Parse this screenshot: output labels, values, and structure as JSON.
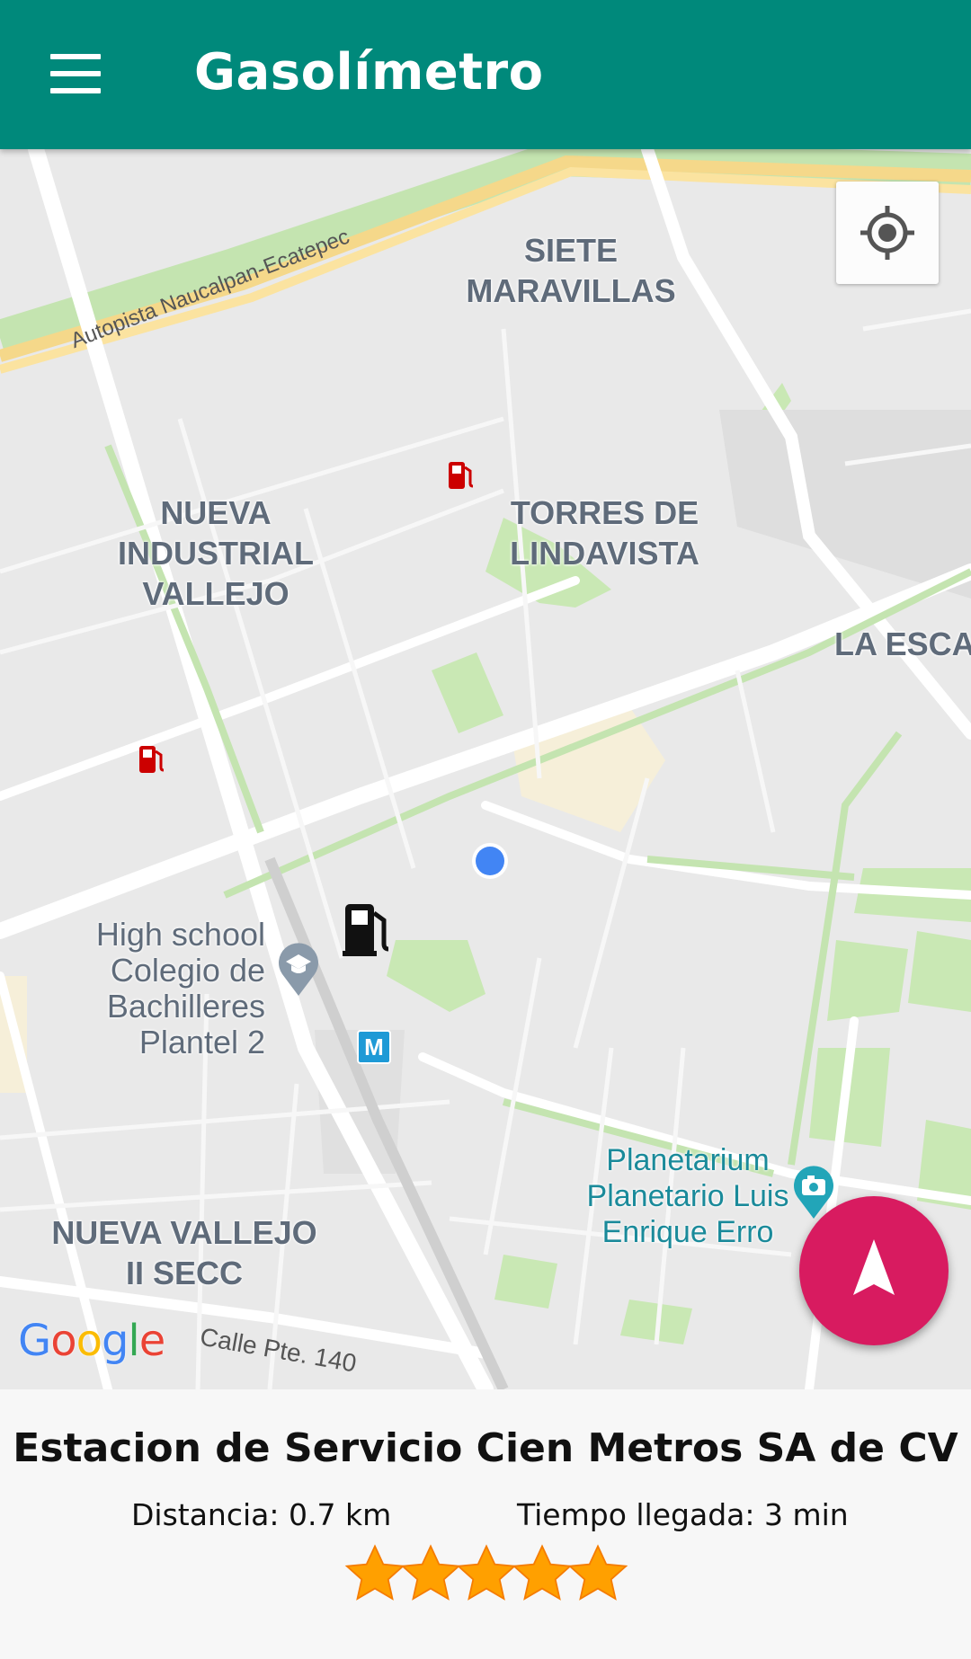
{
  "app": {
    "title": "Gasolímetro",
    "colors": {
      "appbar": "#00897b",
      "fab": "#d81b60",
      "location_dot": "#4285f4",
      "station_marker": "#cc0000"
    }
  },
  "map": {
    "areas": {
      "siete_maravillas": "SIETE\nMARAVILLAS",
      "torres_de_lindavista": "TORRES DE\nLINDAVISTA",
      "nueva_industrial_vallejo": "NUEVA\nINDUSTRIAL\nVALLEJO",
      "la_esca": "LA ESCA",
      "nueva_vallejo": "NUEVA VALLEJO\nII SECC"
    },
    "roads": {
      "autopista": "Autopista Naucalpan-Ecatepec",
      "calle": "Calle Pte. 140"
    },
    "pois": {
      "high_school": "High school\nColegio de\nBachilleres Plantel 2",
      "planetarium": "Planetarium\nPlanetario Luis\nEnrique Erro"
    },
    "icons": {
      "locate": "my-location-icon",
      "station": "gas-station-icon",
      "metro": "metro-icon",
      "navigate": "navigation-arrow-icon"
    },
    "metro_letter": "M",
    "google_logo": "Google"
  },
  "station": {
    "name": "Estacion de Servicio Cien Metros SA de CV",
    "distance": "Distancia: 0.7 km",
    "arrival": "Tiempo llegada: 3 min",
    "rating": 5,
    "rating_max": 5
  }
}
